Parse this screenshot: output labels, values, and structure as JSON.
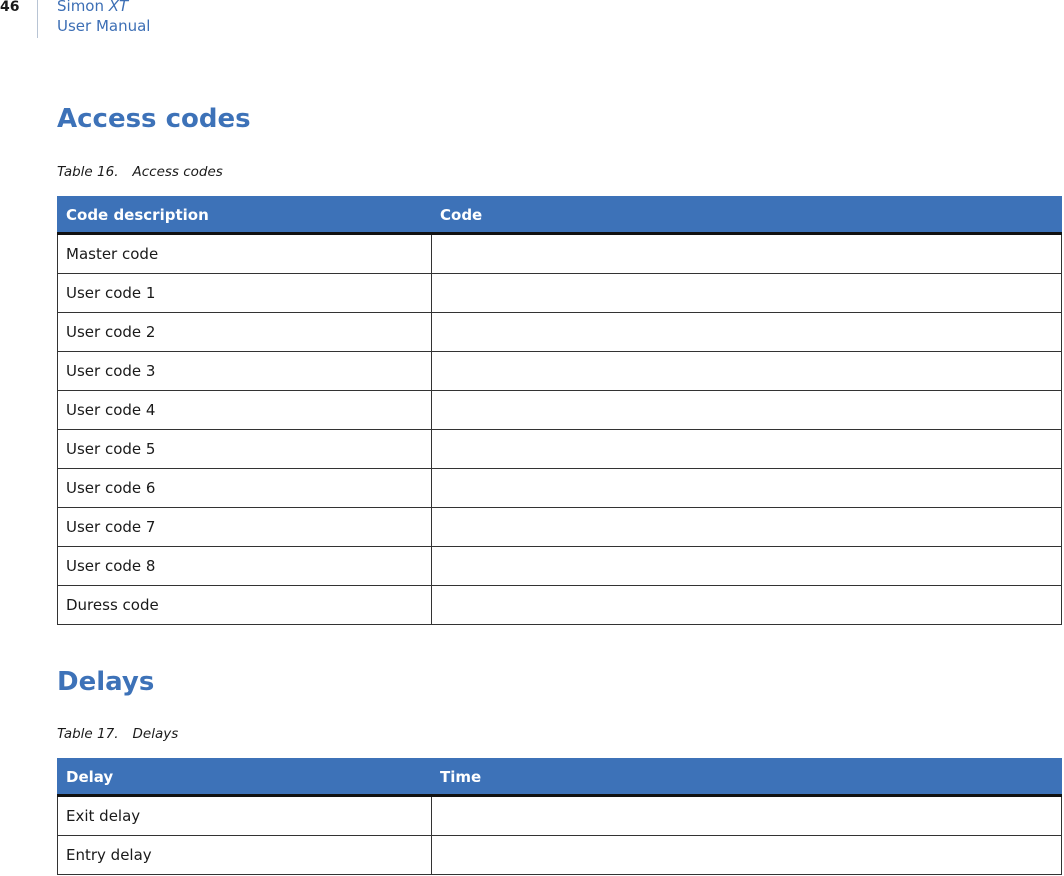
{
  "header": {
    "page_number": "46",
    "product_name": "Simon",
    "product_suffix": "XT",
    "manual_name": "User Manual"
  },
  "access_codes": {
    "heading": "Access codes",
    "caption_number": "Table 16.",
    "caption_title": "Access codes",
    "columns": [
      "Code description",
      "Code"
    ],
    "rows": [
      [
        "Master code",
        ""
      ],
      [
        "User code 1",
        ""
      ],
      [
        "User code 2",
        ""
      ],
      [
        "User code 3",
        ""
      ],
      [
        "User code 4",
        ""
      ],
      [
        "User code 5",
        ""
      ],
      [
        "User code 6",
        ""
      ],
      [
        "User code 7",
        ""
      ],
      [
        "User code 8",
        ""
      ],
      [
        "Duress code",
        ""
      ]
    ]
  },
  "delays": {
    "heading": "Delays",
    "caption_number": "Table 17.",
    "caption_title": "Delays",
    "columns": [
      "Delay",
      "Time"
    ],
    "rows": [
      [
        "Exit delay",
        ""
      ],
      [
        "Entry delay",
        ""
      ]
    ]
  },
  "colors": {
    "accent": "#3d72b8",
    "header_text": "#3d6fb5"
  }
}
